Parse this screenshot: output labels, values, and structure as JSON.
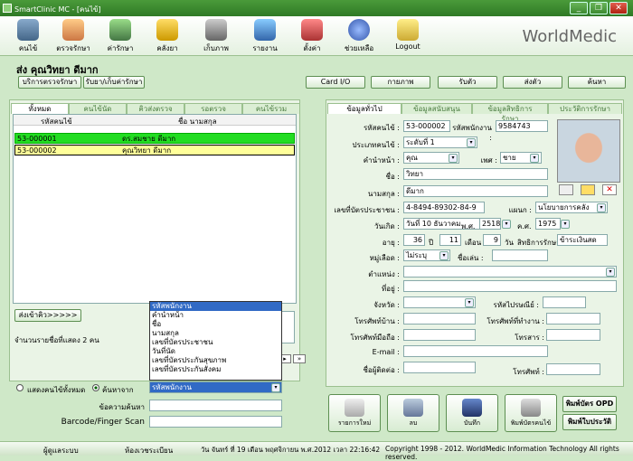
{
  "window": {
    "title": "SmartClinic MC - [คนไข้]"
  },
  "toolbar": {
    "items": [
      "คนไข้",
      "ตรวจรักษา",
      "ค่ารักษา",
      "คลังยา",
      "เก็บภาพ",
      "รายงาน",
      "ตั้งค่า",
      "ช่วยเหลือ",
      "Logout"
    ],
    "logo": "WorldMedic"
  },
  "header": {
    "patient_name": "ส่ง  คุณวิทยา ดีมาก"
  },
  "subbar": {
    "btn1": "บริการตรวจรักษา",
    "btn2": "รับยา/เก็บค่ารักษา"
  },
  "actions": [
    "Card I/O",
    "กายภาพ",
    "รับตัว",
    "ส่งตัว",
    "ค้นหา"
  ],
  "left": {
    "tabs": [
      "ทั้งหมด",
      "คนไข้นัด",
      "คิวส่งตรวจ",
      "รอตรวจ",
      "คนไข้รวม"
    ],
    "columns": [
      "รหัสคนไข้",
      "ชื่อ นามสกุล"
    ],
    "rows": [
      {
        "id": "53-000001",
        "name": "ดร.สมชาย ดีมาก"
      },
      {
        "id": "53-000002",
        "name": "คุณวิทยา ดีมาก"
      }
    ],
    "send_btn": "ส่งเข้าคิว>>>>>",
    "count_text": "จำนวนรายชื่อที่แสดง 2 คน",
    "dropdown_options": [
      "รหัสพนักงาน",
      "คำนำหน้า",
      "ชื่อ",
      "นามสกุล",
      "เลขที่บัตรประชาชน",
      "วันที่นัด",
      "เลขที่บัตรประกันสุขภาพ",
      "เลขที่บัตรประกันสังคม"
    ],
    "radio_all": "แสดงคนไข้ทั้งหมด",
    "radio_search": "ค้นหาจาก",
    "search_by_value": "รหัสพนักงาน",
    "search_text_label": "ข้อความค้นหา",
    "barcode_label": "Barcode/Finger Scan"
  },
  "right": {
    "tabs": [
      "ข้อมูลทั่วไป",
      "ข้อมูลสนับสนุน",
      "ข้อมูลสิทธิการรักษา",
      "ประวัติการรักษา"
    ],
    "labels": {
      "patient_id": "รหัสคนไข้ :",
      "employee_id": "รหัสพนักงาน :",
      "patient_type": "ประเภทคนไข้ :",
      "title": "คำนำหน้า :",
      "sex": "เพศ :",
      "first": "ชื่อ :",
      "last": "นามสกุล :",
      "citizen_id": "เลขที่บัตรประชาชน :",
      "dept": "แผนก :",
      "birth": "วันเกิด :",
      "be": "พ.ศ.",
      "ad": "ค.ศ.",
      "age": "อายุ :",
      "year": "ปี",
      "month": "เดือน",
      "day": "วัน",
      "right_label": "สิทธิการรักษา :",
      "blood": "หมู่เลือด :",
      "nick": "ชื่อเล่น :",
      "position": "ตำแหน่ง :",
      "address": "ที่อยู่ :",
      "province": "จังหวัด :",
      "zip": "รหัสไปรษณีย์ :",
      "home_tel": "โทรศัพท์บ้าน :",
      "work_tel": "โทรศัพท์ที่ทำงาน :",
      "mobile": "โทรศัพท์มือถือ :",
      "fax": "โทรสาร :",
      "email": "E-mail :",
      "contact": "ชื่อผู้ติดต่อ :",
      "tel": "โทรศัพท์ :"
    },
    "values": {
      "patient_id": "53-000002",
      "employee_id": "9584743",
      "patient_type": "ระดับที่ 1",
      "title": "คุณ",
      "sex": "ชาย",
      "first": "วิทยา",
      "last": "ดีมาก",
      "citizen_id": "4-8494-89302-84-9",
      "dept": "นโยบายการคลัง",
      "birth_day": "วันที่ 10",
      "birth_month": "ธันวาคม",
      "birth_be": "2518",
      "birth_ad": "1975",
      "age_y": "36",
      "age_m": "11",
      "age_d": "9",
      "right": "ข้าระเงินสด",
      "blood": "ไม่ระบุ"
    },
    "buttons": [
      "รายการใหม่",
      "ลบ",
      "บันทึก",
      "พิมพ์บัตรคนไข้",
      "พิมพ์บัตร OPD",
      "พิมพ์ใบประวัติ"
    ]
  },
  "status": {
    "user": "ผู้ดูแลระบบ",
    "dept": "ห้องเวชระเบียน",
    "datetime": "วัน จันทร์ ที่ 19 เดือน พฤศจิกายน พ.ศ.2012 เวลา 22:16:42",
    "copyright": "Copyright 1998 - 2012. WorldMedic Information Technology All rights reserved."
  },
  "colors": {
    "selected_row": "#22dd22",
    "highlight_row": "#ffff99",
    "accent": "#2f7a25"
  }
}
